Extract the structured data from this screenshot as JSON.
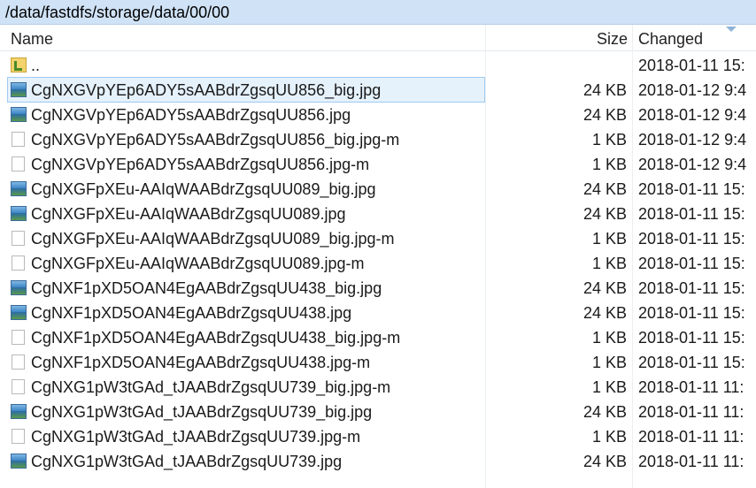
{
  "path": "/data/fastdfs/storage/data/00/00",
  "columns": {
    "name": "Name",
    "size": "Size",
    "changed": "Changed"
  },
  "rows": [
    {
      "name": "..",
      "size": "",
      "changed": "2018-01-11 15:",
      "icon": "parent-folder-icon"
    },
    {
      "name": "CgNXGVpYEp6ADY5sAABdrZgsqUU856_big.jpg",
      "size": "24 KB",
      "changed": "2018-01-12 9:4",
      "icon": "image-file-icon"
    },
    {
      "name": "CgNXGVpYEp6ADY5sAABdrZgsqUU856.jpg",
      "size": "24 KB",
      "changed": "2018-01-12 9:4",
      "icon": "image-file-icon"
    },
    {
      "name": "CgNXGVpYEp6ADY5sAABdrZgsqUU856_big.jpg-m",
      "size": "1 KB",
      "changed": "2018-01-12 9:4",
      "icon": "file-icon"
    },
    {
      "name": "CgNXGVpYEp6ADY5sAABdrZgsqUU856.jpg-m",
      "size": "1 KB",
      "changed": "2018-01-12 9:4",
      "icon": "file-icon"
    },
    {
      "name": "CgNXGFpXEu-AAIqWAABdrZgsqUU089_big.jpg",
      "size": "24 KB",
      "changed": "2018-01-11 15:",
      "icon": "image-file-icon"
    },
    {
      "name": "CgNXGFpXEu-AAIqWAABdrZgsqUU089.jpg",
      "size": "24 KB",
      "changed": "2018-01-11 15:",
      "icon": "image-file-icon"
    },
    {
      "name": "CgNXGFpXEu-AAIqWAABdrZgsqUU089_big.jpg-m",
      "size": "1 KB",
      "changed": "2018-01-11 15:",
      "icon": "file-icon"
    },
    {
      "name": "CgNXGFpXEu-AAIqWAABdrZgsqUU089.jpg-m",
      "size": "1 KB",
      "changed": "2018-01-11 15:",
      "icon": "file-icon"
    },
    {
      "name": "CgNXF1pXD5OAN4EgAABdrZgsqUU438_big.jpg",
      "size": "24 KB",
      "changed": "2018-01-11 15:",
      "icon": "image-file-icon"
    },
    {
      "name": "CgNXF1pXD5OAN4EgAABdrZgsqUU438.jpg",
      "size": "24 KB",
      "changed": "2018-01-11 15:",
      "icon": "image-file-icon"
    },
    {
      "name": "CgNXF1pXD5OAN4EgAABdrZgsqUU438_big.jpg-m",
      "size": "1 KB",
      "changed": "2018-01-11 15:",
      "icon": "file-icon"
    },
    {
      "name": "CgNXF1pXD5OAN4EgAABdrZgsqUU438.jpg-m",
      "size": "1 KB",
      "changed": "2018-01-11 15:",
      "icon": "file-icon"
    },
    {
      "name": "CgNXG1pW3tGAd_tJAABdrZgsqUU739_big.jpg-m",
      "size": "1 KB",
      "changed": "2018-01-11 11:",
      "icon": "file-icon"
    },
    {
      "name": "CgNXG1pW3tGAd_tJAABdrZgsqUU739_big.jpg",
      "size": "24 KB",
      "changed": "2018-01-11 11:",
      "icon": "image-file-icon"
    },
    {
      "name": "CgNXG1pW3tGAd_tJAABdrZgsqUU739.jpg-m",
      "size": "1 KB",
      "changed": "2018-01-11 11:",
      "icon": "file-icon"
    },
    {
      "name": "CgNXG1pW3tGAd_tJAABdrZgsqUU739.jpg",
      "size": "24 KB",
      "changed": "2018-01-11 11:",
      "icon": "image-file-icon"
    }
  ],
  "selected_index": 1,
  "colors": {
    "pathbar_bg": "#cfe2f6",
    "selection_bg": "#e5f1fb",
    "selection_border": "#9fcbf0"
  }
}
